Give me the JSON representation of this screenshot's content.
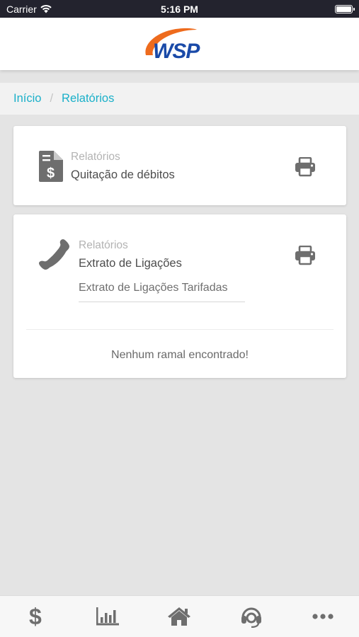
{
  "status_bar": {
    "carrier": "Carrier",
    "time": "5:16 PM"
  },
  "header": {
    "logo_text": "WSP",
    "logo_colors": {
      "orange": "#ee6b1d",
      "blue": "#1a4aa8"
    }
  },
  "breadcrumb": {
    "home": "Início",
    "separator": "/",
    "current": "Relatórios"
  },
  "cards": [
    {
      "icon": "invoice-dollar-icon",
      "category": "Relatórios",
      "title": "Quitação de débitos"
    },
    {
      "icon": "phone-icon",
      "category": "Relatórios",
      "title": "Extrato de Ligações",
      "select_value": "Extrato de Ligações Tarifadas",
      "empty_message": "Nenhum ramal encontrado!"
    }
  ],
  "tab_bar": [
    {
      "icon": "dollar-icon"
    },
    {
      "icon": "bar-chart-icon"
    },
    {
      "icon": "home-icon"
    },
    {
      "icon": "headset-icon"
    },
    {
      "icon": "more-icon"
    }
  ],
  "colors": {
    "accent": "#1ab0c9",
    "icon_gray": "#6e6e6e",
    "background": "#e4e4e4"
  }
}
